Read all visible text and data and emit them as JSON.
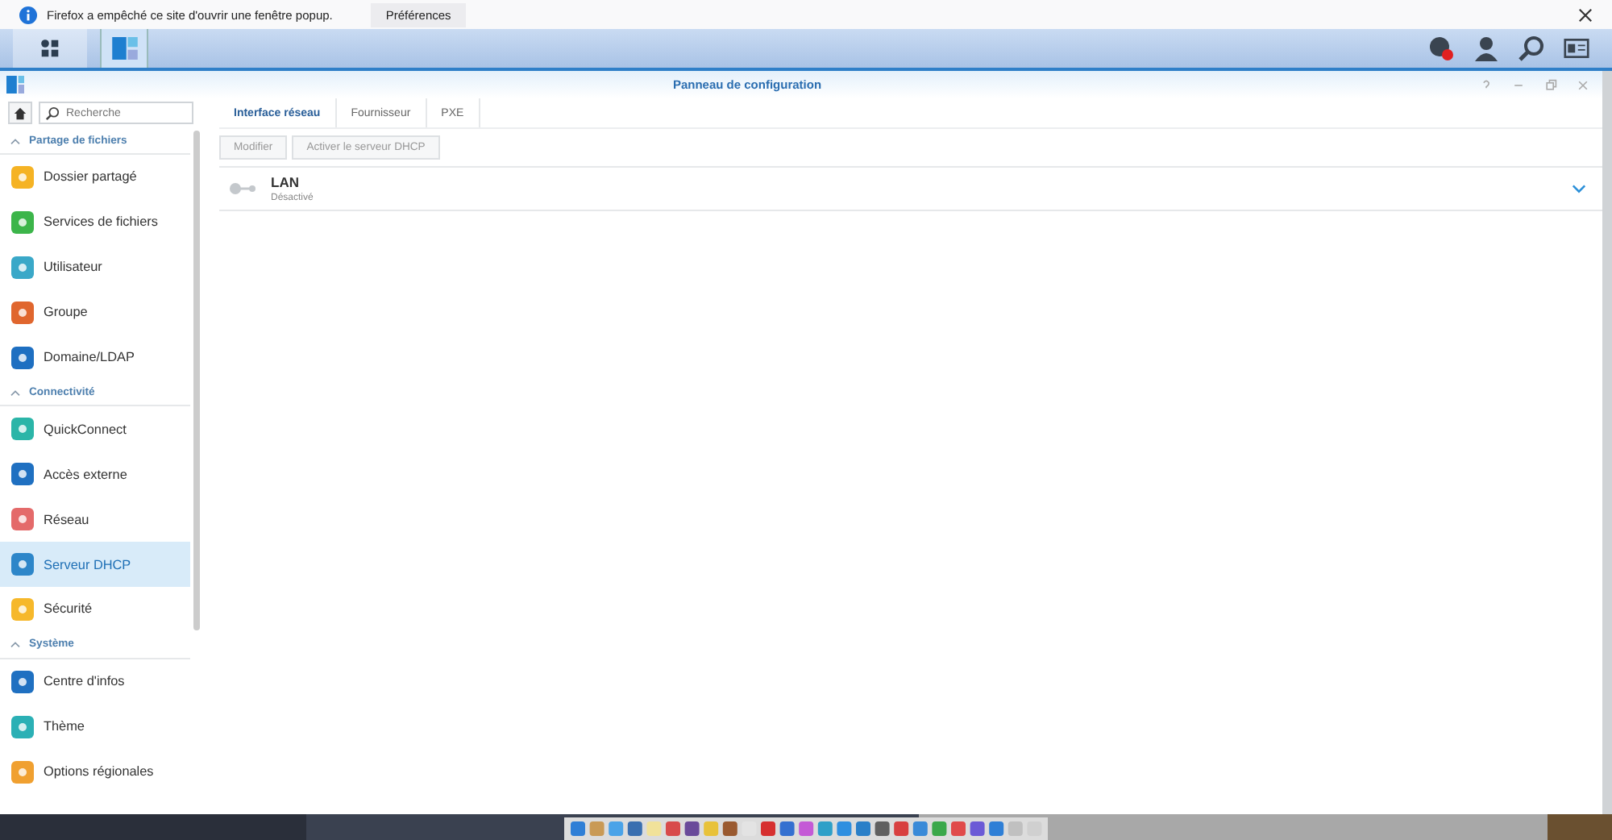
{
  "notification": {
    "message": "Firefox a empêché ce site d'ouvrir une fenêtre popup.",
    "button": "Préférences"
  },
  "taskbar": {
    "apps": [
      {
        "selected": false
      },
      {
        "selected": true
      }
    ],
    "notifications": true
  },
  "window": {
    "title": "Panneau de configuration"
  },
  "search": {
    "placeholder": "Recherche"
  },
  "sidebar": [
    {
      "kind": "section",
      "label": "Partage de fichiers",
      "expanded": true
    },
    {
      "kind": "item",
      "label": "Dossier partagé",
      "selected": false
    },
    {
      "kind": "item",
      "label": "Services de fichiers",
      "selected": false
    },
    {
      "kind": "item",
      "label": "Utilisateur",
      "selected": false
    },
    {
      "kind": "item",
      "label": "Groupe",
      "selected": false
    },
    {
      "kind": "item",
      "label": "Domaine/LDAP",
      "selected": false
    },
    {
      "kind": "section",
      "label": "Connectivité",
      "expanded": true
    },
    {
      "kind": "item",
      "label": "QuickConnect",
      "selected": false
    },
    {
      "kind": "item",
      "label": "Accès externe",
      "selected": false
    },
    {
      "kind": "item",
      "label": "Réseau",
      "selected": false
    },
    {
      "kind": "item",
      "label": "Serveur DHCP",
      "selected": true
    },
    {
      "kind": "item",
      "label": "Sécurité",
      "selected": false
    },
    {
      "kind": "section",
      "label": "Système",
      "expanded": true
    },
    {
      "kind": "item",
      "label": "Centre d'infos",
      "selected": false
    },
    {
      "kind": "item",
      "label": "Thème",
      "selected": false
    },
    {
      "kind": "item",
      "label": "Options régionales",
      "selected": false
    }
  ],
  "tabs": [
    {
      "label": "Interface réseau",
      "selected": true
    },
    {
      "label": "Fournisseur",
      "selected": false
    },
    {
      "label": "PXE",
      "selected": false
    }
  ],
  "toolbar": [
    {
      "label": "Modifier",
      "disabled": true
    },
    {
      "label": "Activer le serveur DHCP",
      "disabled": true
    }
  ],
  "interfaces": [
    {
      "name": "LAN",
      "status": "Désactivé",
      "enabled": false,
      "expanded": false
    }
  ]
}
